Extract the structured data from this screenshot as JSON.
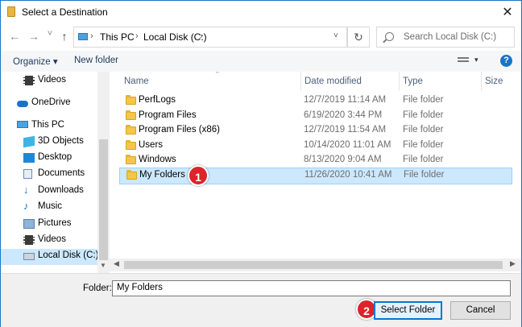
{
  "window": {
    "title": "Select a Destination",
    "close_glyph": "✕"
  },
  "nav": {
    "back_glyph": "←",
    "forward_glyph": "→",
    "recent_glyph": "˅",
    "up_glyph": "↑",
    "refresh_glyph": "↻"
  },
  "address": {
    "segments": [
      "This PC",
      "Local Disk (C:)"
    ],
    "separator": "›",
    "dropdown_glyph": "˅"
  },
  "search": {
    "placeholder": "Search Local Disk (C:)"
  },
  "toolbar": {
    "organize_label": "Organize ▾",
    "new_folder_label": "New folder",
    "view_drop_glyph": "▾",
    "help_glyph": "?"
  },
  "sidebar": {
    "items": [
      {
        "label": "Videos",
        "icon": "video-icon",
        "level": 2
      },
      {
        "label": "OneDrive",
        "icon": "cloud-icon",
        "level": 1
      },
      {
        "label": "This PC",
        "icon": "pc-icon",
        "level": 1
      },
      {
        "label": "3D Objects",
        "icon": "cube-icon",
        "level": 2
      },
      {
        "label": "Desktop",
        "icon": "desktop-icon",
        "level": 2
      },
      {
        "label": "Documents",
        "icon": "document-icon",
        "level": 2
      },
      {
        "label": "Downloads",
        "icon": "download-icon",
        "level": 2
      },
      {
        "label": "Music",
        "icon": "music-icon",
        "level": 2
      },
      {
        "label": "Pictures",
        "icon": "picture-icon",
        "level": 2
      },
      {
        "label": "Videos",
        "icon": "video-icon",
        "level": 2
      },
      {
        "label": "Local Disk (C:)",
        "icon": "drive-icon",
        "level": 2,
        "selected": true
      }
    ]
  },
  "columns": {
    "name": "Name",
    "date": "Date modified",
    "type": "Type",
    "size": "Size",
    "sort_glyph": "^"
  },
  "files": [
    {
      "name": "PerfLogs",
      "date": "12/7/2019 11:14 AM",
      "type": "File folder"
    },
    {
      "name": "Program Files",
      "date": "6/19/2020 3:44 PM",
      "type": "File folder"
    },
    {
      "name": "Program Files (x86)",
      "date": "12/7/2019 11:54 AM",
      "type": "File folder"
    },
    {
      "name": "Users",
      "date": "10/14/2020 11:01 AM",
      "type": "File folder"
    },
    {
      "name": "Windows",
      "date": "8/13/2020 9:04 AM",
      "type": "File folder"
    },
    {
      "name": "My Folders",
      "date": "11/26/2020 10:41 AM",
      "type": "File folder",
      "selected": true
    }
  ],
  "annotations": {
    "step1": "1",
    "step2": "2"
  },
  "scrollbar": {
    "left_glyph": "◀",
    "right_glyph": "▶",
    "down_glyph": "▼"
  },
  "footer": {
    "folder_label": "Folder:",
    "folder_value": "My Folders",
    "select_button": "Select Folder",
    "cancel_button": "Cancel"
  },
  "colors": {
    "accent": "#0078d7",
    "selection": "#cce8ff",
    "badge": "#d9252b"
  }
}
